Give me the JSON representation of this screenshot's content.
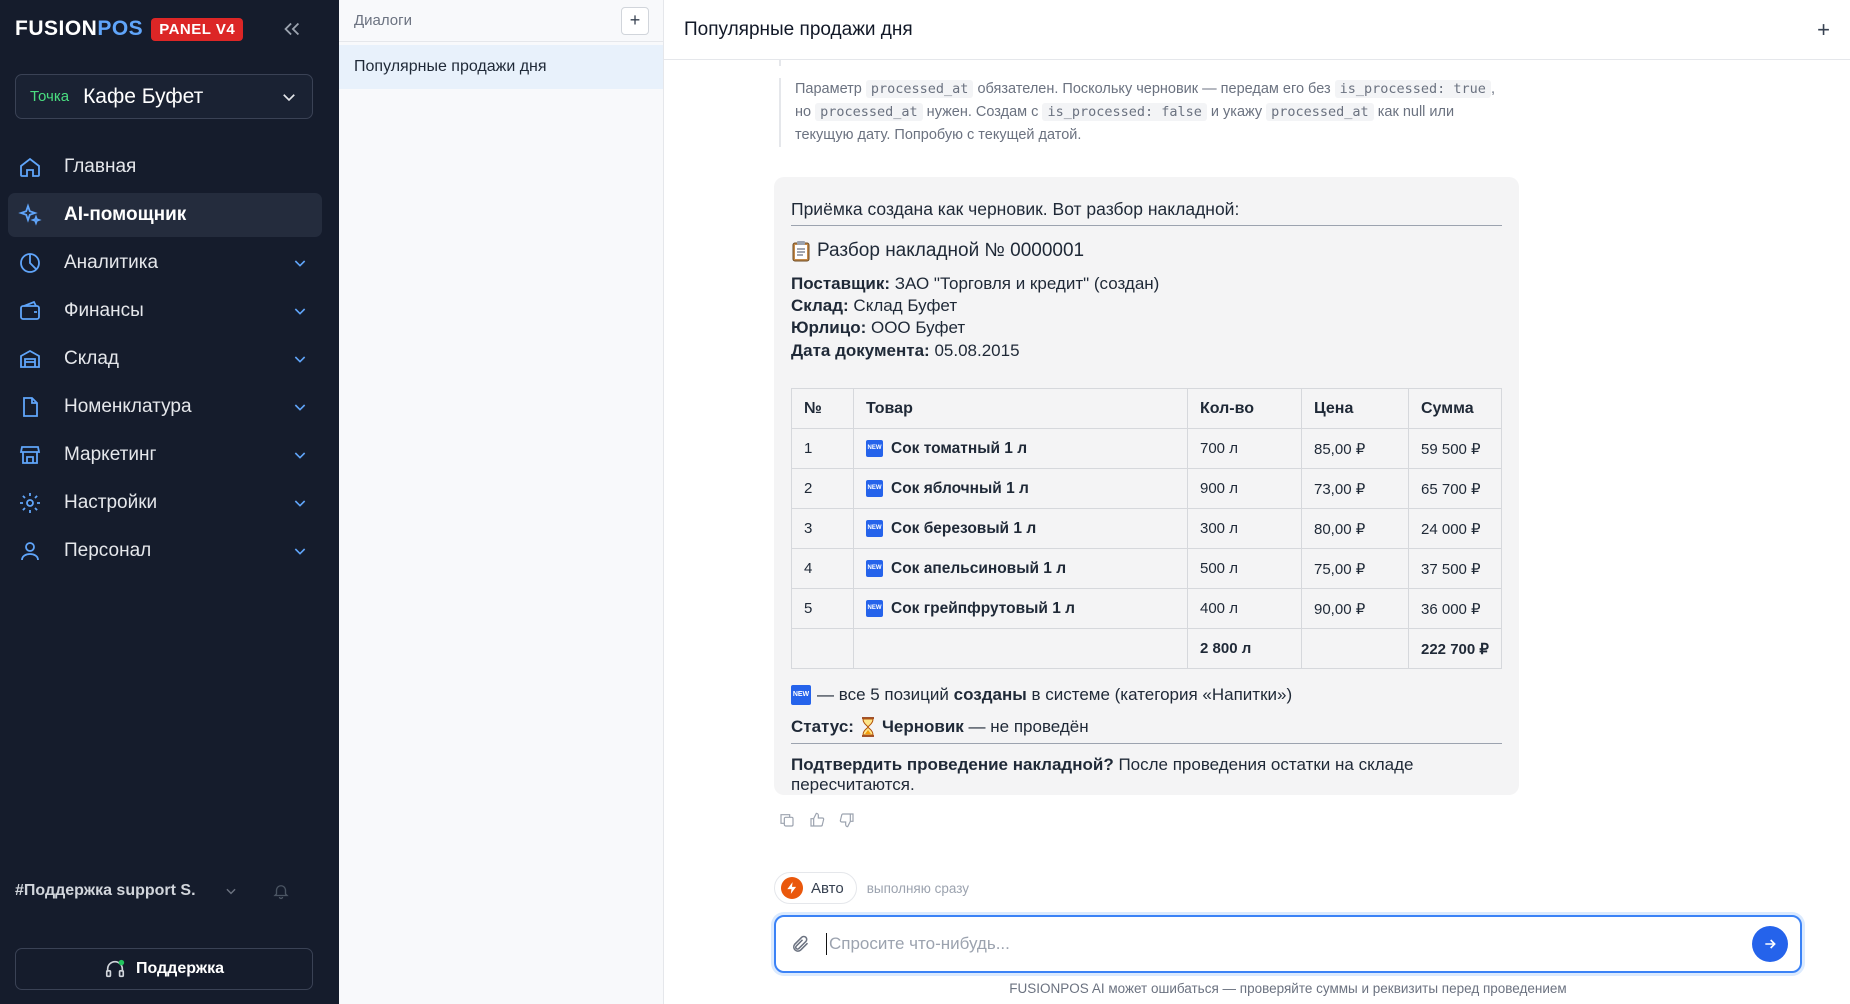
{
  "sidebar": {
    "brand": {
      "name_a": "FUSION",
      "name_b": "POS",
      "badge": "PANEL V4"
    },
    "point": {
      "tag": "Точка",
      "name": "Кафе Буфет"
    },
    "nav": [
      {
        "label": "Главная",
        "icon": "home-icon"
      },
      {
        "label": "AI-помощник",
        "icon": "sparkles-icon",
        "active": true
      },
      {
        "label": "Аналитика",
        "icon": "chart-pie-icon"
      },
      {
        "label": "Финансы",
        "icon": "wallet-icon"
      },
      {
        "label": "Склад",
        "icon": "warehouse-icon"
      },
      {
        "label": "Номенклатура",
        "icon": "document-icon"
      },
      {
        "label": "Маркетинг",
        "icon": "store-icon"
      },
      {
        "label": "Настройки",
        "icon": "gear-icon"
      },
      {
        "label": "Персонал",
        "icon": "user-icon"
      }
    ],
    "support_channel": "#Поддержка support S.",
    "support_button": "Поддержка"
  },
  "dialogs": {
    "title": "Диалоги",
    "add": "+",
    "items": [
      "Популярные продажи дня"
    ]
  },
  "chat": {
    "title": "Популярные продажи дня",
    "new": "+",
    "thinking": {
      "t1": "Параметр ",
      "c1": "processed_at",
      "t2": " обязателен. Поскольку черновик — передам его без ",
      "c2": "is_processed: true",
      "t3": ", но ",
      "c3": "processed_at",
      "t4": " нужен. Создам с ",
      "c4": "is_processed: false",
      "t5": " и укажу ",
      "c5": "processed_at",
      "t6": " как null или текущую дату. Попробую с текущей датой."
    },
    "answer": {
      "intro": "Приёмка создана как черновик. Вот разбор накладной:",
      "heading": "Разбор накладной № 0000001",
      "supplier_label": "Поставщик:",
      "supplier_value": " ЗАО \"Торговля и кредит\" (создан)",
      "warehouse_label": "Склад:",
      "warehouse_value": " Склад Буфет",
      "entity_label": "Юрлицо:",
      "entity_value": " ООО Буфет",
      "date_label": "Дата документа:",
      "date_value": " 05.08.2015",
      "table": {
        "headers": [
          "№",
          "Товар",
          "Кол-во",
          "Цена",
          "Сумма"
        ],
        "rows": [
          {
            "n": "1",
            "item": "Сок томатный 1 л",
            "qty": "700 л",
            "price": "85,00 ₽",
            "sum": "59 500 ₽"
          },
          {
            "n": "2",
            "item": "Сок яблочный 1 л",
            "qty": "900 л",
            "price": "73,00 ₽",
            "sum": "65 700 ₽"
          },
          {
            "n": "3",
            "item": "Сок березовый 1 л",
            "qty": "300 л",
            "price": "80,00 ₽",
            "sum": "24 000 ₽"
          },
          {
            "n": "4",
            "item": "Сок апельсиновый 1 л",
            "qty": "500 л",
            "price": "75,00 ₽",
            "sum": "37 500 ₽"
          },
          {
            "n": "5",
            "item": "Сок грейпфрутовый 1 л",
            "qty": "400 л",
            "price": "90,00 ₽",
            "sum": "36 000 ₽"
          }
        ],
        "total_qty": "2 800 л",
        "total_sum": "222 700 ₽"
      },
      "note_a": " — все 5 позиций ",
      "note_b": "созданы",
      "note_c": " в системе (категория «Напитки»)",
      "status_label": "Статус:",
      "status_value": "Черновик",
      "status_tail": " — не проведён",
      "confirm_bold": "Подтвердить проведение накладной?",
      "confirm_rest": " После проведения остатки на складе пересчитаются."
    },
    "mode": {
      "label": "Авто",
      "hint": "выполняю сразу"
    },
    "input": {
      "placeholder": "Спросите что-нибудь..."
    },
    "disclaimer": "FUSIONPOS AI может ошибаться — проверяйте суммы и реквизиты перед проведением"
  },
  "colors": {
    "sidebar_bg": "#151c2c",
    "accent": "#2563eb",
    "brand_badge": "#dc2626",
    "point_tag": "#4ade80"
  }
}
